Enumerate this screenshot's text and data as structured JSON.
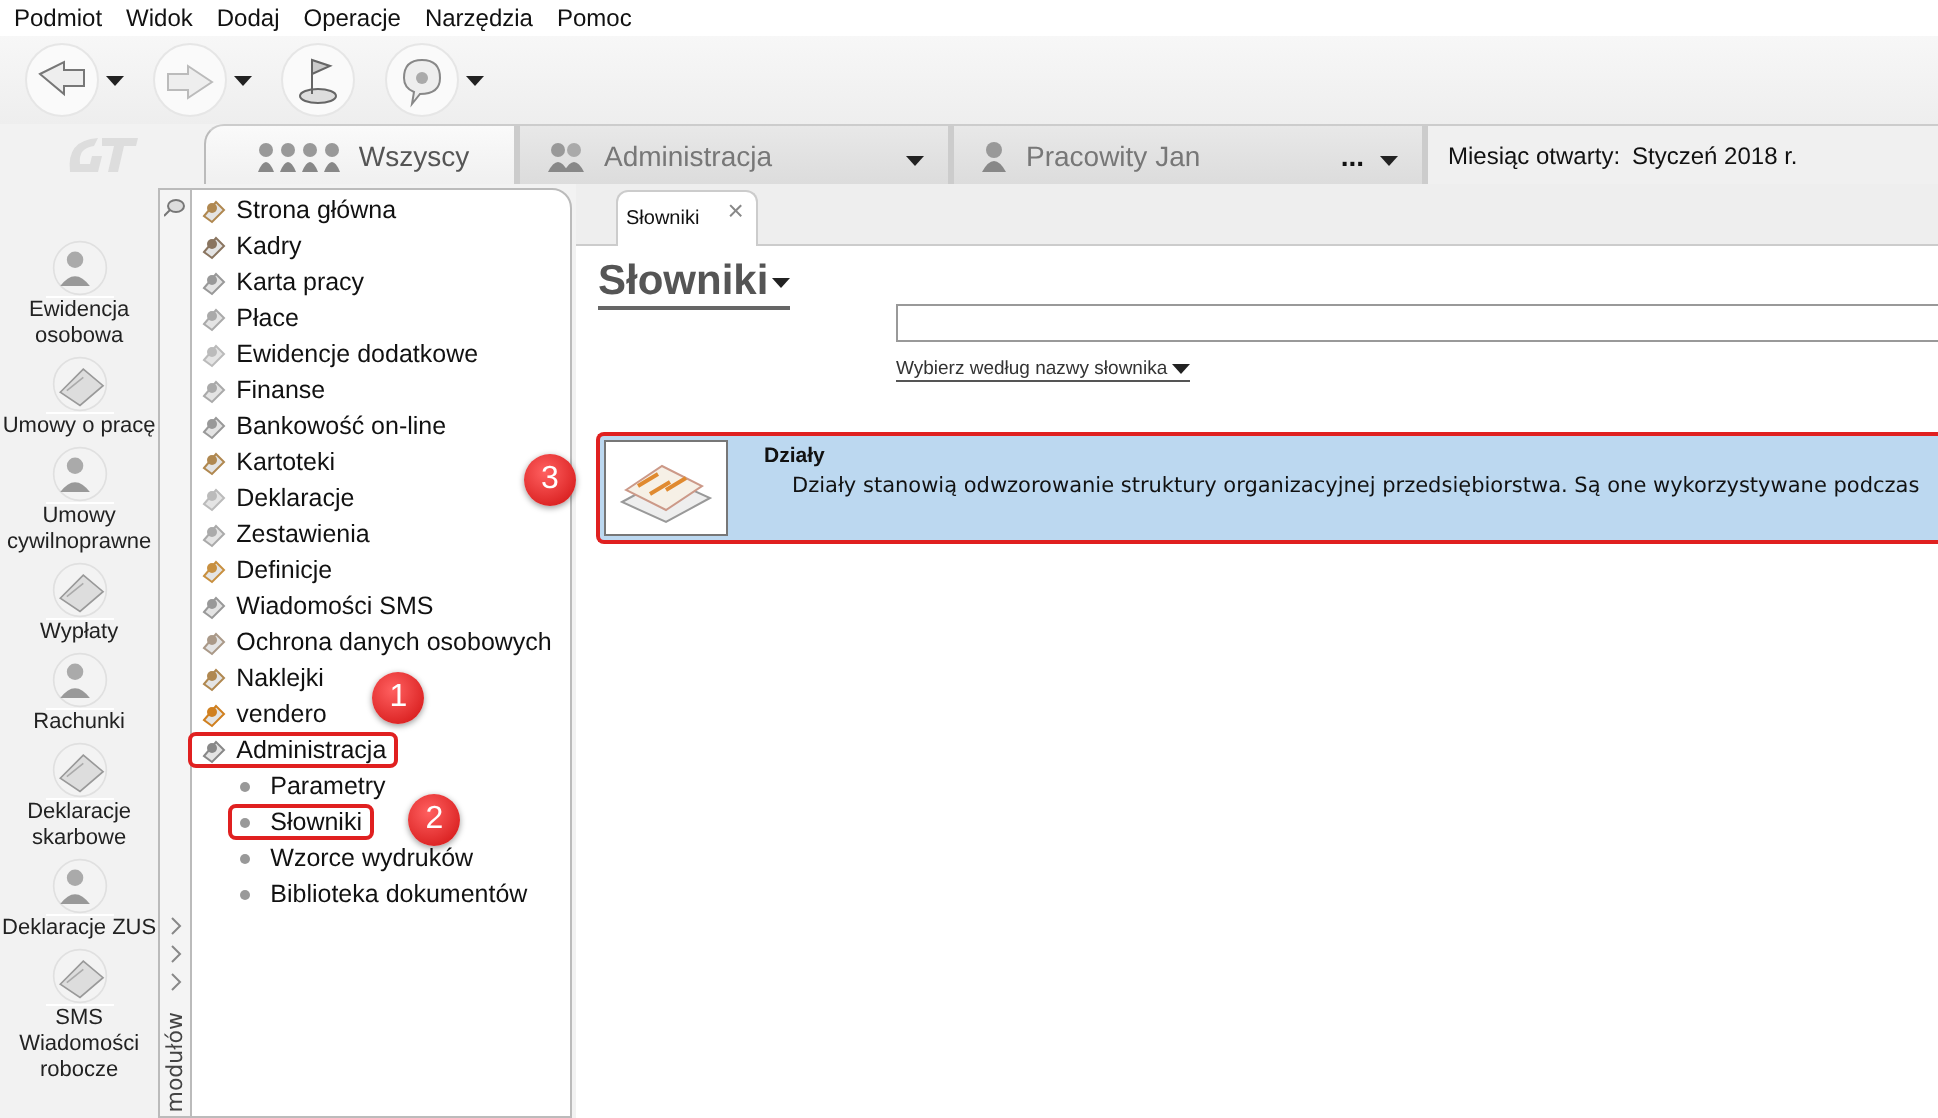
{
  "menu": [
    "Podmiot",
    "Widok",
    "Dodaj",
    "Operacje",
    "Narzędzia",
    "Pomoc"
  ],
  "top_tabs": [
    {
      "label": "Wszyscy",
      "kind": "group",
      "selected": true
    },
    {
      "label": "Administracja",
      "kind": "dropdown",
      "selected": false
    },
    {
      "label": "Pracowity Jan",
      "kind": "person",
      "extra": "...",
      "selected": false
    }
  ],
  "month": {
    "label": "Miesiąc otwarty:",
    "value": "Styczeń 2018 r."
  },
  "modules": [
    "Ewidencja\nosobowa",
    "Umowy o pracę",
    "Umowy\ncywilnoprawne",
    "Wypłaty",
    "Rachunki",
    "Deklaracje\nskarbowe",
    "Deklaracje ZUS",
    "SMS\nWiadomości\nrobocze"
  ],
  "modules_strip": {
    "label": "modułów"
  },
  "tree": [
    {
      "label": "Strona główna"
    },
    {
      "label": "Kadry"
    },
    {
      "label": "Karta pracy"
    },
    {
      "label": "Płace"
    },
    {
      "label": "Ewidencje dodatkowe"
    },
    {
      "label": "Finanse"
    },
    {
      "label": "Bankowość on-line"
    },
    {
      "label": "Kartoteki"
    },
    {
      "label": "Deklaracje"
    },
    {
      "label": "Zestawienia"
    },
    {
      "label": "Definicje"
    },
    {
      "label": "Wiadomości SMS"
    },
    {
      "label": "Ochrona danych osobowych"
    },
    {
      "label": "Naklejki"
    },
    {
      "label": "vendero",
      "callout": "1"
    },
    {
      "label": "Administracja",
      "highlighted": true,
      "children": [
        {
          "label": "Parametry",
          "highlighted": false
        },
        {
          "label": "Słowniki",
          "highlighted": true,
          "callout": "2"
        },
        {
          "label": "Wzorce wydruków",
          "highlighted": false
        },
        {
          "label": "Biblioteka dokumentów",
          "highlighted": false
        }
      ]
    }
  ],
  "doc_tab": {
    "label": "Słowniki",
    "close": "×"
  },
  "heading": "Słowniki",
  "filter_link": "Wybierz według nazwy słownika",
  "dictionaries": [
    {
      "title": "Działy",
      "description": "Działy stanowią odwzorowanie struktury organizacyjnej przedsiębiorstwa. Są one wykorzystywane podczas",
      "selected": true,
      "highlighted": true,
      "callout": "3"
    }
  ]
}
